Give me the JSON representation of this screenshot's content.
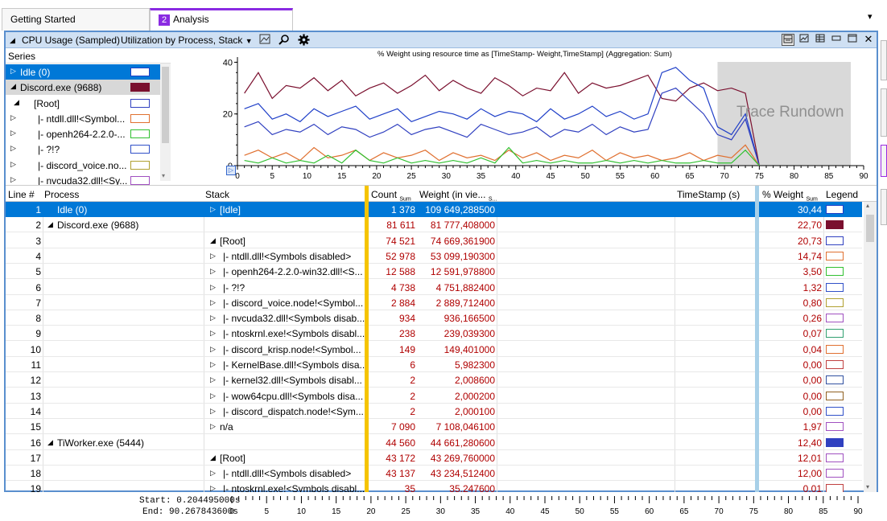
{
  "tabs": [
    {
      "label": "Getting Started"
    },
    {
      "number": "2",
      "label": "Analysis"
    }
  ],
  "viewbar": {
    "graph_name": "CPU Usage (Sampled)",
    "preset": "Utilization by Process, Stack"
  },
  "series": {
    "header": "Series",
    "items": [
      {
        "label": "Idle (0)",
        "color": "#1f3fc8",
        "filled": false,
        "selected": true
      },
      {
        "label": "Discord.exe (9688)",
        "color": "#7a0f2e",
        "filled": true
      },
      {
        "label": "[Root]",
        "color": "#3040c0",
        "filled": false
      },
      {
        "label": "|- ntdll.dll!<Symbol...",
        "color": "#e07030",
        "filled": false
      },
      {
        "label": "|- openh264-2.2.0-...",
        "color": "#30c030",
        "filled": false
      },
      {
        "label": "|- ?!?",
        "color": "#3050c8",
        "filled": false
      },
      {
        "label": "|- discord_voice.no...",
        "color": "#b0a030",
        "filled": false
      },
      {
        "label": "|- nvcuda32.dll!<Sy...",
        "color": "#a050c0",
        "filled": false
      }
    ]
  },
  "graph": {
    "title": "% Weight using resource time as [TimeStamp- Weight,TimeStamp] (Aggregation: Sum)",
    "overlay_label": "Trace Rundown"
  },
  "chart_data": {
    "type": "line",
    "title": "% Weight using resource time as [TimeStamp- Weight,TimeStamp] (Aggregation: Sum)",
    "xlim": [
      0,
      90
    ],
    "ylim": [
      0,
      42
    ],
    "x_ticks": [
      "0",
      "5",
      "10",
      "15",
      "20",
      "25",
      "30",
      "35",
      "40",
      "45",
      "50",
      "55",
      "60",
      "65",
      "70",
      "75",
      "80",
      "85",
      "90"
    ],
    "y_ticks": [
      "0",
      "20",
      "40"
    ],
    "shaded_region_x": [
      69,
      90
    ],
    "series": [
      {
        "name": "Discord.exe (9688)",
        "color": "#7a0f2e",
        "x": [
          1,
          3,
          5,
          7,
          9,
          11,
          13,
          15,
          17,
          19,
          21,
          23,
          25,
          27,
          29,
          31,
          33,
          35,
          37,
          39,
          41,
          43,
          45,
          47,
          49,
          51,
          53,
          55,
          57,
          59,
          61,
          63,
          65,
          67,
          69,
          71,
          73,
          75
        ],
        "values": [
          28,
          36,
          26,
          31,
          30,
          34,
          29,
          33,
          27,
          30,
          32,
          28,
          31,
          35,
          29,
          33,
          30,
          28,
          34,
          31,
          27,
          30,
          29,
          36,
          28,
          32,
          30,
          31,
          33,
          35,
          26,
          25,
          30,
          32,
          29,
          30,
          28,
          0
        ]
      },
      {
        "name": "Idle (0)",
        "color": "#1f3fc8",
        "x": [
          1,
          3,
          5,
          7,
          9,
          11,
          13,
          15,
          17,
          19,
          21,
          23,
          25,
          27,
          29,
          31,
          33,
          35,
          37,
          39,
          41,
          43,
          45,
          47,
          49,
          51,
          53,
          55,
          57,
          59,
          61,
          63,
          65,
          67,
          69,
          71,
          73,
          75
        ],
        "values": [
          22,
          24,
          18,
          20,
          17,
          22,
          19,
          21,
          23,
          18,
          20,
          22,
          17,
          19,
          21,
          20,
          18,
          22,
          19,
          21,
          20,
          17,
          22,
          18,
          20,
          23,
          19,
          21,
          18,
          20,
          36,
          38,
          33,
          30,
          15,
          12,
          20,
          0
        ]
      },
      {
        "name": "[Root]",
        "color": "#3040c0",
        "x": [
          1,
          3,
          5,
          7,
          9,
          11,
          13,
          15,
          17,
          19,
          21,
          23,
          25,
          27,
          29,
          31,
          33,
          35,
          37,
          39,
          41,
          43,
          45,
          47,
          49,
          51,
          53,
          55,
          57,
          59,
          61,
          63,
          65,
          67,
          69,
          71,
          73,
          75
        ],
        "values": [
          15,
          17,
          12,
          14,
          13,
          16,
          12,
          15,
          14,
          11,
          13,
          16,
          12,
          14,
          15,
          13,
          11,
          16,
          14,
          12,
          13,
          15,
          11,
          14,
          13,
          16,
          12,
          15,
          13,
          14,
          28,
          30,
          25,
          20,
          12,
          10,
          18,
          0
        ]
      },
      {
        "name": "|- ntdll.dll!<Symbols disabled>",
        "color": "#e07030",
        "x": [
          1,
          3,
          5,
          7,
          9,
          11,
          13,
          15,
          17,
          19,
          21,
          23,
          25,
          27,
          29,
          31,
          33,
          35,
          37,
          39,
          41,
          43,
          45,
          47,
          49,
          51,
          53,
          55,
          57,
          59,
          61,
          63,
          65,
          67,
          69,
          71,
          73,
          75
        ],
        "values": [
          4,
          6,
          3,
          5,
          2,
          7,
          3,
          4,
          6,
          2,
          5,
          3,
          4,
          6,
          2,
          5,
          3,
          4,
          2,
          6,
          3,
          5,
          2,
          4,
          3,
          6,
          2,
          5,
          3,
          4,
          2,
          3,
          5,
          2,
          4,
          3,
          8,
          0
        ]
      },
      {
        "name": "|- openh264-2.2.0-win32.dll!<Symbols disabled>",
        "color": "#30c030",
        "x": [
          1,
          3,
          5,
          7,
          9,
          11,
          13,
          15,
          17,
          19,
          21,
          23,
          25,
          27,
          29,
          31,
          33,
          35,
          37,
          39,
          41,
          43,
          45,
          47,
          49,
          51,
          53,
          55,
          57,
          59,
          61,
          63,
          65,
          67,
          69,
          71,
          73,
          75
        ],
        "values": [
          2,
          1,
          3,
          1,
          2,
          1,
          4,
          1,
          6,
          2,
          1,
          3,
          1,
          2,
          1,
          2,
          1,
          3,
          1,
          7,
          1,
          2,
          1,
          2,
          1,
          1,
          2,
          1,
          2,
          1,
          2,
          1,
          1,
          2,
          1,
          1,
          6,
          0
        ]
      }
    ]
  },
  "table": {
    "columns": {
      "line": "Line #",
      "process": "Process",
      "stack": "Stack",
      "count": "Count",
      "count_agg": "Sum",
      "weight": "Weight (in vie...",
      "weight_agg": "S...",
      "timestamp": "TimeStamp (s)",
      "pct": "% Weight",
      "pct_agg": "Sum",
      "legend": "Legend"
    },
    "rows": [
      {
        "line": "1",
        "process": "Idle (0)",
        "pexp": "",
        "stack": "[Idle]",
        "sexp": "▷",
        "indent": 0,
        "count": "1 378",
        "weight": "109 649,288500",
        "pct": "30,44",
        "color": "#1f3fc8",
        "filled": false,
        "selected": true
      },
      {
        "line": "2",
        "process": "Discord.exe (9688)",
        "pexp": "◢",
        "stack": "",
        "sexp": "",
        "indent": 0,
        "count": "81 611",
        "weight": "81 777,408000",
        "pct": "22,70",
        "color": "#7a0f2e",
        "filled": true
      },
      {
        "line": "3",
        "process": "",
        "pexp": "",
        "stack": "[Root]",
        "sexp": "◢",
        "indent": 0,
        "count": "74 521",
        "weight": "74 669,361900",
        "pct": "20,73",
        "color": "#3040c0",
        "filled": false
      },
      {
        "line": "4",
        "process": "",
        "pexp": "",
        "stack": "|- ntdll.dll!<Symbols disabled>",
        "sexp": "▷",
        "indent": 1,
        "count": "52 978",
        "weight": "53 099,190300",
        "pct": "14,74",
        "color": "#e07030",
        "filled": false
      },
      {
        "line": "5",
        "process": "",
        "pexp": "",
        "stack": "|- openh264-2.2.0-win32.dll!<S...",
        "sexp": "▷",
        "indent": 1,
        "count": "12 588",
        "weight": "12 591,978800",
        "pct": "3,50",
        "color": "#30c030",
        "filled": false
      },
      {
        "line": "6",
        "process": "",
        "pexp": "",
        "stack": "|- ?!?",
        "sexp": "▷",
        "indent": 1,
        "count": "4 738",
        "weight": "4 751,882400",
        "pct": "1,32",
        "color": "#3050c8",
        "filled": false
      },
      {
        "line": "7",
        "process": "",
        "pexp": "",
        "stack": "|- discord_voice.node!<Symbol...",
        "sexp": "▷",
        "indent": 1,
        "count": "2 884",
        "weight": "2 889,712400",
        "pct": "0,80",
        "color": "#b0a030",
        "filled": false
      },
      {
        "line": "8",
        "process": "",
        "pexp": "",
        "stack": "|- nvcuda32.dll!<Symbols disab...",
        "sexp": "▷",
        "indent": 1,
        "count": "934",
        "weight": "936,166500",
        "pct": "0,26",
        "color": "#a050c0",
        "filled": false
      },
      {
        "line": "9",
        "process": "",
        "pexp": "",
        "stack": "|- ntoskrnl.exe!<Symbols disabl...",
        "sexp": "▷",
        "indent": 1,
        "count": "238",
        "weight": "239,039300",
        "pct": "0,07",
        "color": "#30a070",
        "filled": false
      },
      {
        "line": "10",
        "process": "",
        "pexp": "",
        "stack": "|- discord_krisp.node!<Symbol...",
        "sexp": "▷",
        "indent": 1,
        "count": "149",
        "weight": "149,401000",
        "pct": "0,04",
        "color": "#e07030",
        "filled": false
      },
      {
        "line": "11",
        "process": "",
        "pexp": "",
        "stack": "|- KernelBase.dll!<Symbols disa...",
        "sexp": "▷",
        "indent": 1,
        "count": "6",
        "weight": "5,982300",
        "pct": "0,00",
        "color": "#c04040",
        "filled": false
      },
      {
        "line": "12",
        "process": "",
        "pexp": "",
        "stack": "|- kernel32.dll!<Symbols disabl...",
        "sexp": "▷",
        "indent": 1,
        "count": "2",
        "weight": "2,008600",
        "pct": "0,00",
        "color": "#3050a0",
        "filled": false
      },
      {
        "line": "13",
        "process": "",
        "pexp": "",
        "stack": "|- wow64cpu.dll!<Symbols disa...",
        "sexp": "▷",
        "indent": 1,
        "count": "2",
        "weight": "2,000200",
        "pct": "0,00",
        "color": "#906020",
        "filled": false
      },
      {
        "line": "14",
        "process": "",
        "pexp": "",
        "stack": "|- discord_dispatch.node!<Sym...",
        "sexp": "▷",
        "indent": 1,
        "count": "2",
        "weight": "2,000100",
        "pct": "0,00",
        "color": "#3050c8",
        "filled": false
      },
      {
        "line": "15",
        "process": "",
        "pexp": "",
        "stack": "n/a",
        "sexp": "▷",
        "indent": 0,
        "count": "7 090",
        "weight": "7 108,046100",
        "pct": "1,97",
        "color": "#a050c0",
        "filled": false
      },
      {
        "line": "16",
        "process": "TiWorker.exe (5444)",
        "pexp": "◢",
        "stack": "",
        "sexp": "",
        "indent": 0,
        "count": "44 560",
        "weight": "44 661,280600",
        "pct": "12,40",
        "color": "#3040c0",
        "filled": true
      },
      {
        "line": "17",
        "process": "",
        "pexp": "",
        "stack": "[Root]",
        "sexp": "◢",
        "indent": 0,
        "count": "43 172",
        "weight": "43 269,760000",
        "pct": "12,01",
        "color": "#a050c0",
        "filled": false
      },
      {
        "line": "18",
        "process": "",
        "pexp": "",
        "stack": "|- ntdll.dll!<Symbols disabled>",
        "sexp": "▷",
        "indent": 1,
        "count": "43 137",
        "weight": "43 234,512400",
        "pct": "12,00",
        "color": "#a050c0",
        "filled": false
      },
      {
        "line": "19",
        "process": "",
        "pexp": "",
        "stack": "|- ntoskrnl.exe!<Symbols disabl...",
        "sexp": "▷",
        "indent": 1,
        "count": "35",
        "weight": "35,247600",
        "pct": "0,01",
        "color": "#c04040",
        "filled": false
      }
    ]
  },
  "timeline": {
    "start_label": "Start:",
    "start_value": "0.204495000s",
    "end_label": "End:",
    "end_value": "90.267843600s"
  }
}
